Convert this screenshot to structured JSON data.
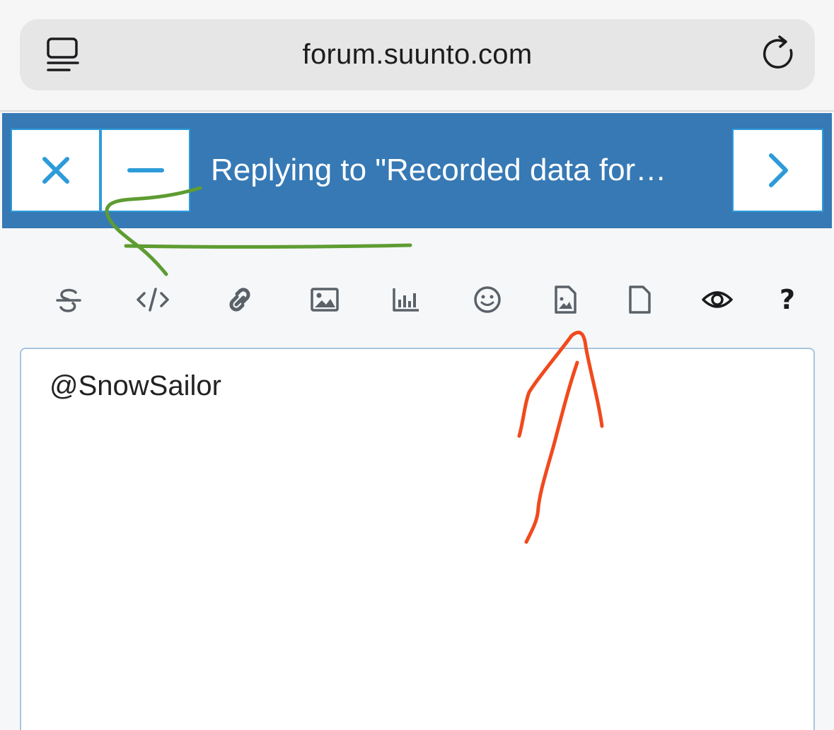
{
  "browser": {
    "url": "forum.suunto.com",
    "reader_icon": "reader-mode-icon",
    "reload_icon": "reload-icon"
  },
  "composer": {
    "title": "Replying to \"Recorded data for…",
    "close_icon": "close-icon",
    "minimize_icon": "minimize-icon",
    "submit_icon": "chevron-right-icon",
    "accent_color": "#3679b5",
    "button_icon_color": "#2d9bd9"
  },
  "toolbar": {
    "items": [
      {
        "icon": "strikethrough-icon"
      },
      {
        "icon": "code-icon"
      },
      {
        "icon": "link-icon"
      },
      {
        "icon": "image-icon"
      },
      {
        "icon": "chart-icon"
      },
      {
        "icon": "emoji-icon"
      },
      {
        "icon": "image-file-icon"
      },
      {
        "icon": "file-icon"
      },
      {
        "icon": "preview-eye-icon"
      },
      {
        "icon": "help-icon",
        "glyph": "?"
      }
    ]
  },
  "editor": {
    "content": "@SnowSailor"
  },
  "annotations": {
    "green_arrow_color": "#5e9c32",
    "red_arrow_color": "#f04a1d"
  }
}
